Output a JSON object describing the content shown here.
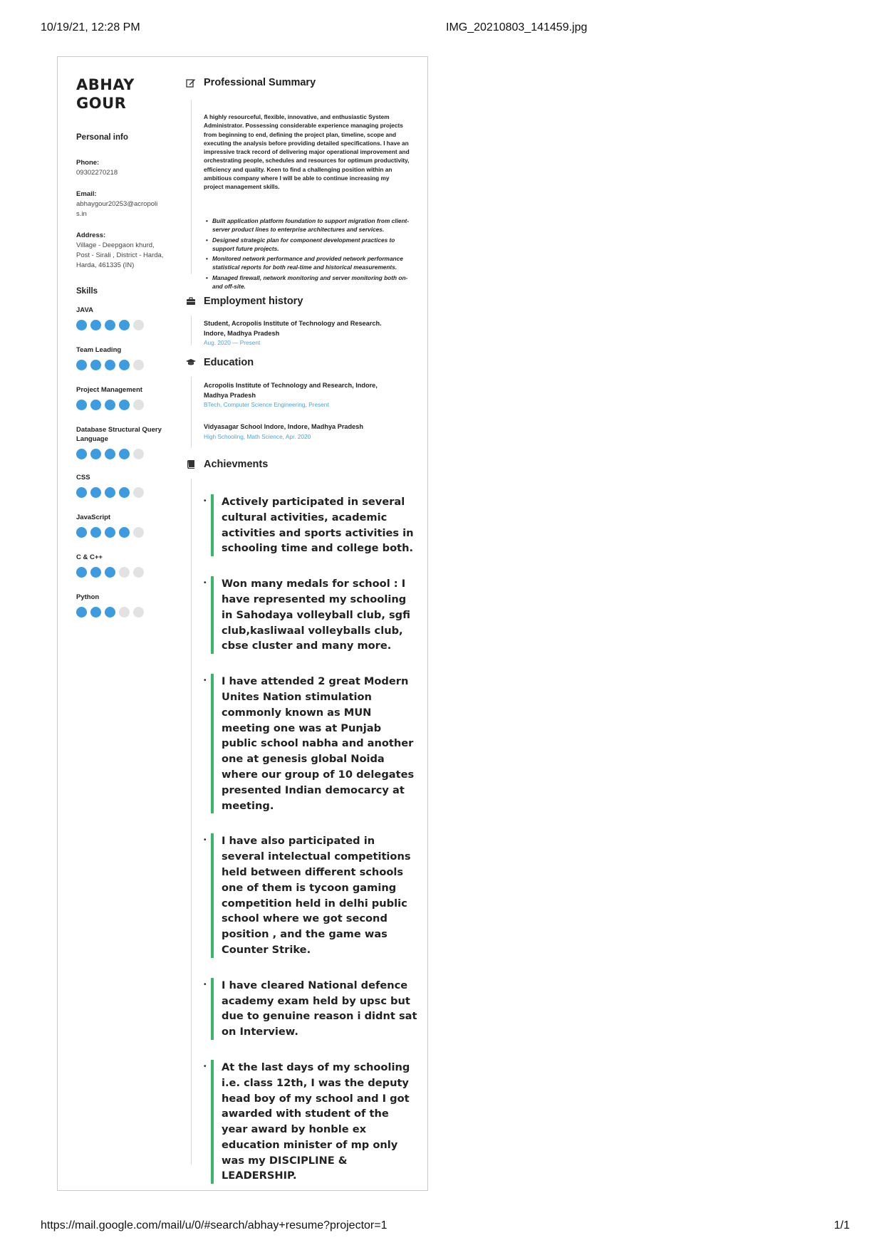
{
  "print_header": {
    "datetime": "10/19/21, 12:28 PM",
    "filename": "IMG_20210803_141459.jpg"
  },
  "print_footer": {
    "url": "https://mail.google.com/mail/u/0/#search/abhay+resume?projector=1",
    "page": "1/1"
  },
  "resume": {
    "name_first": "ABHAY",
    "name_last": "GOUR",
    "personal_info_heading": "Personal info",
    "phone_label": "Phone:",
    "phone": "09302270218",
    "email_label": "Email:",
    "email": "abhaygour20253@acropolis.in",
    "address_label": "Address:",
    "address": "Village - Deepgaon khurd, Post - Sirali , District - Harda, Harda, 461335 (IN)",
    "skills_heading": "Skills",
    "skills": [
      {
        "name": "JAVA",
        "level": 4,
        "max": 5
      },
      {
        "name": "Team Leading",
        "level": 4,
        "max": 5
      },
      {
        "name": "Project Management",
        "level": 4,
        "max": 5
      },
      {
        "name": "Database Structural Query Language",
        "level": 4,
        "max": 5
      },
      {
        "name": "CSS",
        "level": 4,
        "max": 5
      },
      {
        "name": "JavaScript",
        "level": 4,
        "max": 5
      },
      {
        "name": "C & C++",
        "level": 3,
        "max": 5
      },
      {
        "name": "Python",
        "level": 3,
        "max": 5
      }
    ],
    "summary": {
      "heading": "Professional Summary",
      "icon": "edit-icon",
      "text": "A highly resourceful, flexible, innovative, and enthusiastic System Administrator. Possessing considerable experience managing projects from beginning to end, defining the project plan, timeline, scope and executing the analysis before providing detailed specifications. I have an impressive track record of delivering major operational improvement and orchestrating people, schedules and resources for optimum productivity, efficiency and quality. Keen to find a challenging position within an ambitious company where I will be able to continue increasing my project management skills.",
      "bullets": [
        "Built application platform foundation to support migration from client-server product lines to enterprise architectures and services.",
        "Designed strategic plan for component development practices to support future projects.",
        "Monitored network performance and provided network performance statistical reports for both real-time and historical measurements.",
        "Managed firewall, network monitoring and server monitoring both on- and off-site."
      ]
    },
    "employment": {
      "heading": "Employment history",
      "icon": "briefcase-icon",
      "title": "Student, Acropolis Institute of Technology and Research. Indore, Madhya Pradesh",
      "dates": "Aug. 2020 — Present"
    },
    "education": {
      "heading": "Education",
      "icon": "graduation-cap-icon",
      "entries": [
        {
          "title": "Acropolis Institute of Technology and Research, Indore, Madhya Pradesh",
          "detail": "BTech, Computer Science Engineering, Present"
        },
        {
          "title": "Vidyasagar School Indore, Indore, Madhya Pradesh",
          "detail": "High Schooling, Math Science, Apr. 2020"
        }
      ]
    },
    "achievements": {
      "heading": "Achievments",
      "icon": "book-icon",
      "bullet": "•",
      "items": [
        "Actively participated in several cultural activities, academic activities and sports activities in schooling time and college both.",
        "Won many medals for school  : I have represented my schooling in Sahodaya volleyball club, sgfi club,kasliwaal volleyballs club, cbse cluster and many more.",
        "I have attended 2 great Modern Unites Nation stimulation commonly known as MUN meeting one was at Punjab public school nabha and another one at genesis global Noida where our group of 10 delegates presented Indian democarcy at meeting.",
        "I have also participated in several intelectual competitions held between different schools one of them is tycoon gaming competition held in delhi public school where we got second position , and the game was Counter Strike.",
        "I have cleared National defence academy exam held by upsc but due to genuine reason i didnt sat on Interview.",
        "At the last days of my schooling i.e. class 12th, I was the deputy head boy of my school and I got awarded with student of the year award by honble ex education minister of mp only was my DISCIPLINE & LEADERSHIP."
      ]
    },
    "colors": {
      "dot_on": "#3d9be0",
      "dot_off": "#e2e2e2",
      "accent_bar": "#3ab56c",
      "date_text": "#4aa3d9"
    }
  }
}
